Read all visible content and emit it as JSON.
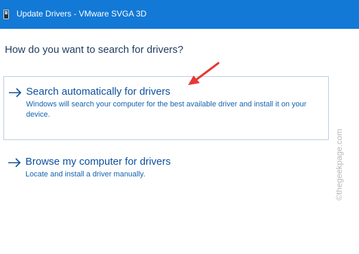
{
  "window": {
    "title": "Update Drivers - VMware SVGA 3D",
    "titlebar_color": "#1279d6",
    "icon": "device-manager-icon"
  },
  "main": {
    "question": "How do you want to search for drivers?",
    "options": [
      {
        "icon": "right-arrow-icon",
        "title": "Search automatically for drivers",
        "description": "Windows will search your computer for the best available driver and install it on your device."
      },
      {
        "icon": "right-arrow-icon",
        "title": "Browse my computer for drivers",
        "description": "Locate and install a driver manually."
      }
    ]
  },
  "annotation": {
    "icon": "red-pointer-arrow-icon",
    "color": "#e53935"
  },
  "watermark": {
    "text": "©thegeekpage.com"
  }
}
